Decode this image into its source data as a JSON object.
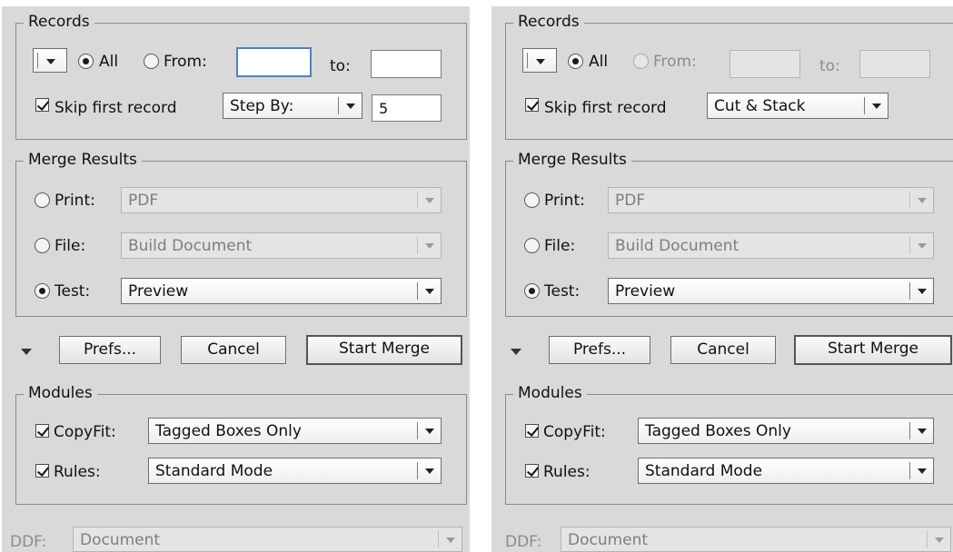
{
  "left": {
    "records": {
      "legend": "Records",
      "all_label": "All",
      "from_label": "From:",
      "from_value": "",
      "to_label": "to:",
      "to_value": "",
      "skip_label": "Skip first record",
      "mode_value": "Step By:",
      "step_value": "5"
    },
    "merge": {
      "legend": "Merge Results",
      "print_label": "Print:",
      "print_value": "PDF",
      "file_label": "File:",
      "file_value": "Build Document",
      "test_label": "Test:",
      "test_value": "Preview"
    },
    "buttons": {
      "prefs": "Prefs...",
      "cancel": "Cancel",
      "start": "Start Merge"
    },
    "modules": {
      "legend": "Modules",
      "copyfit_label": "CopyFit:",
      "copyfit_value": "Tagged Boxes Only",
      "rules_label": "Rules:",
      "rules_value": "Standard Mode"
    },
    "ddf": {
      "label": "DDF:",
      "value": "Document"
    }
  },
  "right": {
    "records": {
      "legend": "Records",
      "all_label": "All",
      "from_label": "From:",
      "from_value": "",
      "to_label": "to:",
      "to_value": "",
      "skip_label": "Skip first record",
      "mode_value": "Cut & Stack"
    },
    "merge": {
      "legend": "Merge Results",
      "print_label": "Print:",
      "print_value": "PDF",
      "file_label": "File:",
      "file_value": "Build Document",
      "test_label": "Test:",
      "test_value": "Preview"
    },
    "buttons": {
      "prefs": "Prefs...",
      "cancel": "Cancel",
      "start": "Start Merge"
    },
    "modules": {
      "legend": "Modules",
      "copyfit_label": "CopyFit:",
      "copyfit_value": "Tagged Boxes Only",
      "rules_label": "Rules:",
      "rules_value": "Standard Mode"
    },
    "ddf": {
      "label": "DDF:",
      "value": "Document"
    }
  },
  "colors": {
    "panel_bg": "#d9d9d9",
    "focus_ring": "#4d82c4",
    "disabled_text": "#8c8c8c"
  },
  "icons": {
    "disclosure": "disclosure-triangle-icon",
    "dropdown": "chevron-down-icon"
  }
}
